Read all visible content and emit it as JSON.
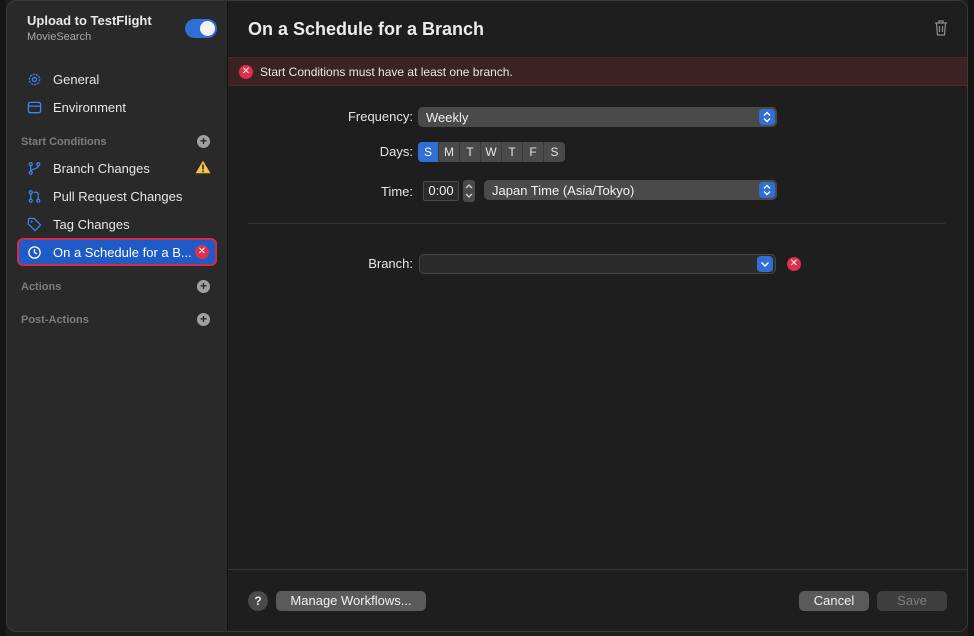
{
  "sidebar": {
    "workflow_title": "Upload to TestFlight",
    "workflow_subtitle": "MovieSearch",
    "enabled": true,
    "items": [
      {
        "label": "General",
        "icon": "gear-icon"
      },
      {
        "label": "Environment",
        "icon": "environment-icon"
      }
    ],
    "start_conditions": {
      "label": "Start Conditions",
      "items": [
        {
          "label": "Branch Changes",
          "icon": "branch-icon",
          "status": "warning"
        },
        {
          "label": "Pull Request Changes",
          "icon": "pull-request-icon"
        },
        {
          "label": "Tag Changes",
          "icon": "tag-icon"
        },
        {
          "label": "On a Schedule for a B...",
          "icon": "clock-icon",
          "status": "error",
          "selected": true
        }
      ]
    },
    "actions_label": "Actions",
    "post_actions_label": "Post-Actions"
  },
  "main": {
    "title": "On a Schedule for a Branch",
    "error_message": "Start Conditions must have at least one branch.",
    "frequency_label": "Frequency:",
    "frequency_value": "Weekly",
    "days_label": "Days:",
    "days": [
      {
        "label": "S",
        "selected": true
      },
      {
        "label": "M",
        "selected": false
      },
      {
        "label": "T",
        "selected": false
      },
      {
        "label": "W",
        "selected": false
      },
      {
        "label": "T",
        "selected": false
      },
      {
        "label": "F",
        "selected": false
      },
      {
        "label": "S",
        "selected": false
      }
    ],
    "time_label": "Time:",
    "time_value": "0:00",
    "timezone_value": "Japan Time (Asia/Tokyo)",
    "branch_label": "Branch:",
    "branch_value": ""
  },
  "footer": {
    "help_label": "?",
    "manage_label": "Manage Workflows...",
    "cancel_label": "Cancel",
    "save_label": "Save"
  },
  "colors": {
    "accent": "#2f6fd6",
    "error": "#e0304a",
    "warning": "#f5c343"
  }
}
